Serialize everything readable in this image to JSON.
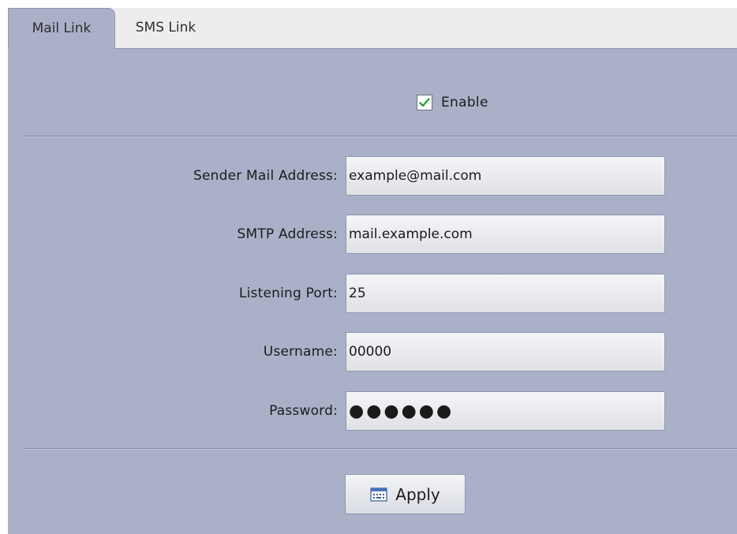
{
  "tabs": {
    "mail_link": "Mail Link",
    "sms_link": "SMS Link"
  },
  "enable": {
    "label": "Enable",
    "checked": true
  },
  "fields": {
    "sender_mail_address": {
      "label": "Sender Mail Address:",
      "value": "example@mail.com"
    },
    "smtp_address": {
      "label": "SMTP Address:",
      "value": "mail.example.com"
    },
    "listening_port": {
      "label": "Listening Port:",
      "value": "25"
    },
    "username": {
      "label": "Username:",
      "value": "00000"
    },
    "password": {
      "label": "Password:",
      "value": "●●●●●●"
    }
  },
  "apply": {
    "label": "Apply",
    "icon": "keyboard-icon"
  },
  "colors": {
    "panel": "#aab0c8",
    "tab_bar": "#ededed",
    "check": "#2aa33a"
  }
}
